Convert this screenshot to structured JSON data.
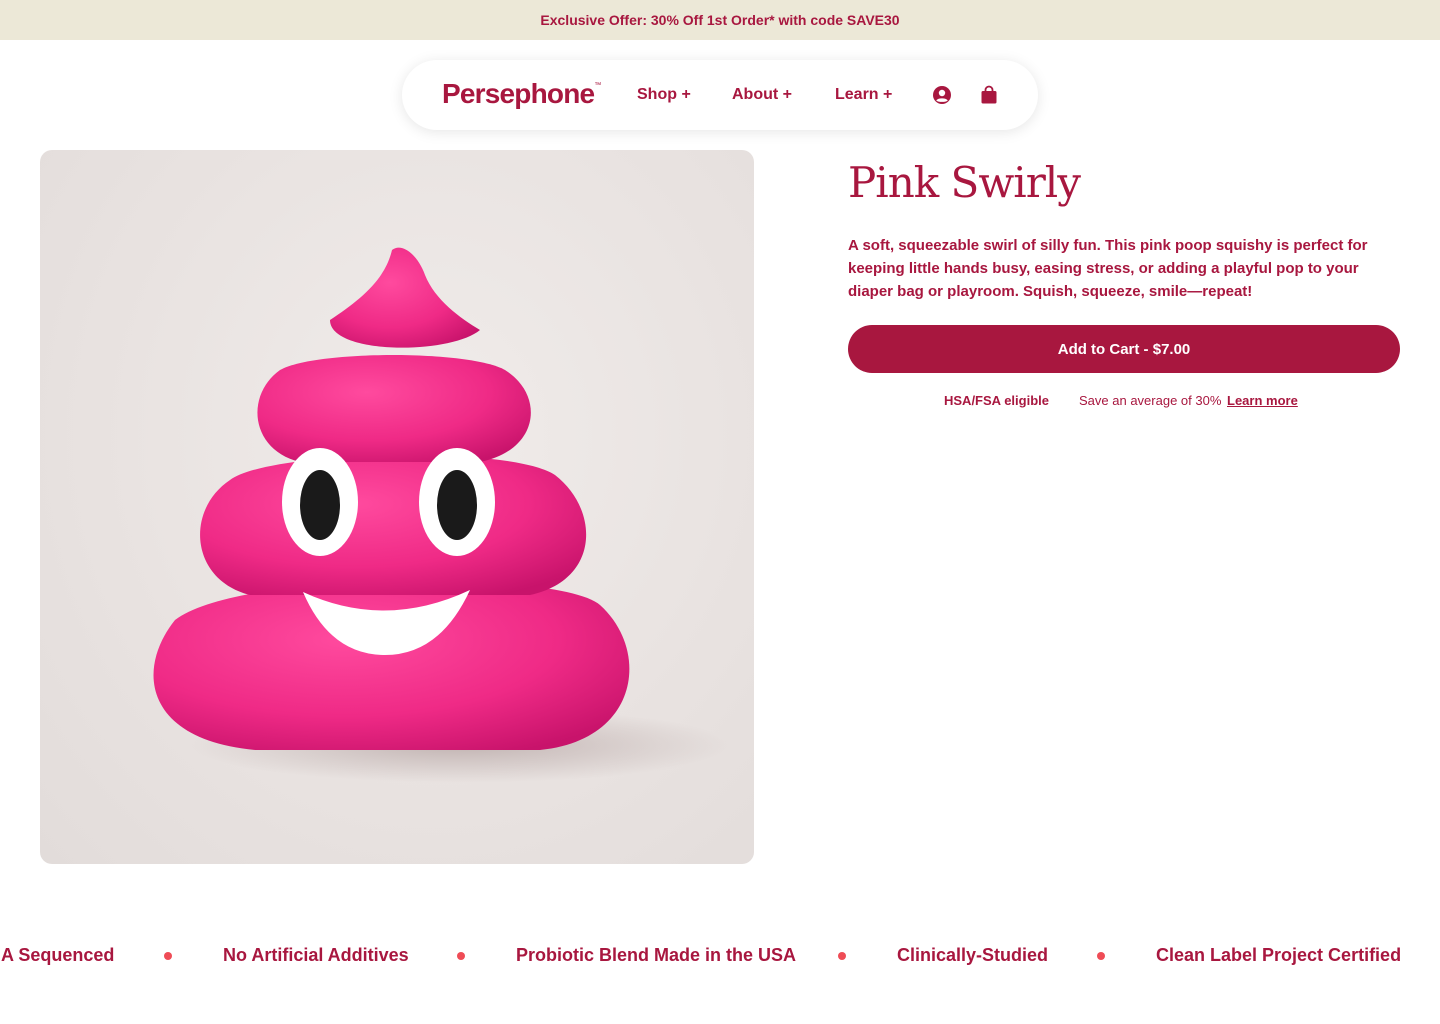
{
  "promo": {
    "text": "Exclusive Offer: 30% Off 1st Order* with code SAVE30"
  },
  "nav": {
    "logo": "Persephone",
    "logo_mark": "™",
    "items": [
      {
        "label": "Shop +"
      },
      {
        "label": "About +"
      },
      {
        "label": "Learn +"
      }
    ],
    "icons": [
      "account-icon",
      "shopping-bag-icon"
    ]
  },
  "product": {
    "image_name": "pink-poop-squishy",
    "title": "Pink Swirly",
    "description": "A soft, squeezable swirl of silly fun. This pink poop squishy is perfect for keeping little hands busy, easing stress, or adding a playful pop to your diaper bag or playroom. Squish, squeeze, smile—repeat!",
    "cart_button": "Add to Cart - $7.00",
    "hsa_label": "HSA/FSA eligible",
    "savings_text": "Save an average of 30%",
    "learn_more": "Learn more"
  },
  "marquee": {
    "items": [
      "NA Sequenced",
      "No Artificial Additives",
      "Probiotic Blend Made in the USA",
      "Clinically-Studied",
      "Clean Label Project Certified"
    ]
  },
  "colors": {
    "brand": "#a8173f",
    "promo_bg": "#ece8d7",
    "dot": "#ef4c56",
    "product_pink": "#ef2a86"
  }
}
